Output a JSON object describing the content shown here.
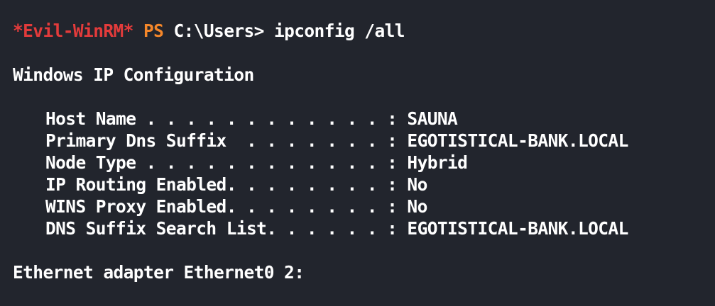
{
  "prompt": {
    "tag": "*Evil-WinRM*",
    "shell": "PS",
    "path": "C:\\Users>",
    "command": "ipconfig /all"
  },
  "output": {
    "header": "Windows IP Configuration",
    "entries": [
      {
        "label": "Host Name . . . . . . . . . . . . :",
        "value": "SAUNA"
      },
      {
        "label": "Primary Dns Suffix  . . . . . . . :",
        "value": "EGOTISTICAL-BANK.LOCAL"
      },
      {
        "label": "Node Type . . . . . . . . . . . . :",
        "value": "Hybrid"
      },
      {
        "label": "IP Routing Enabled. . . . . . . . :",
        "value": "No"
      },
      {
        "label": "WINS Proxy Enabled. . . . . . . . :",
        "value": "No"
      },
      {
        "label": "DNS Suffix Search List. . . . . . :",
        "value": "EGOTISTICAL-BANK.LOCAL"
      }
    ],
    "adapter_header": "Ethernet adapter Ethernet0 2:"
  },
  "colors": {
    "background": "#22252d",
    "prompt_tag": "#e33b3b",
    "shell": "#f5872a",
    "text": "#ffffff"
  }
}
